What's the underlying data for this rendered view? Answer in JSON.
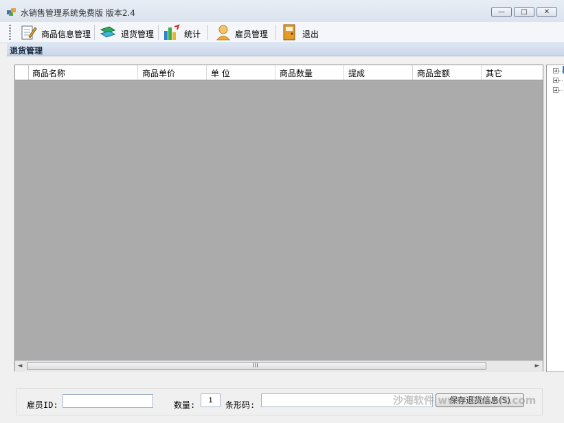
{
  "window": {
    "title": "水销售管理系统免费版 版本2.4",
    "min_glyph": "—",
    "max_glyph": "□",
    "close_glyph": "✕"
  },
  "toolbar": {
    "items": [
      {
        "label": "商品信息管理",
        "icon": "edit-icon"
      },
      {
        "label": "退货管理",
        "icon": "return-icon"
      },
      {
        "label": "统计",
        "icon": "stats-icon"
      },
      {
        "label": "雇员管理",
        "icon": "employee-icon"
      },
      {
        "label": "退出",
        "icon": "exit-icon"
      }
    ]
  },
  "child": {
    "title": "退货管理"
  },
  "grid": {
    "columns": [
      "商品名称",
      "商品单价",
      "单 位",
      "商品数量",
      "提成",
      "商品金额",
      "其它"
    ],
    "scroll_grip": "III",
    "scroll_left": "◄",
    "scroll_right": "►"
  },
  "form": {
    "employee_label": "雇员ID:",
    "employee_value": "",
    "quantity_label": "数量:",
    "quantity_value": "1",
    "barcode_label": "条形码:",
    "barcode_value": "",
    "save_label": "保存退货信息(S)"
  },
  "watermark": "沙海软件 www.ShSoft.com",
  "colors": {
    "grid_background": "#ababab",
    "titlebar": "#dbe3ee"
  }
}
